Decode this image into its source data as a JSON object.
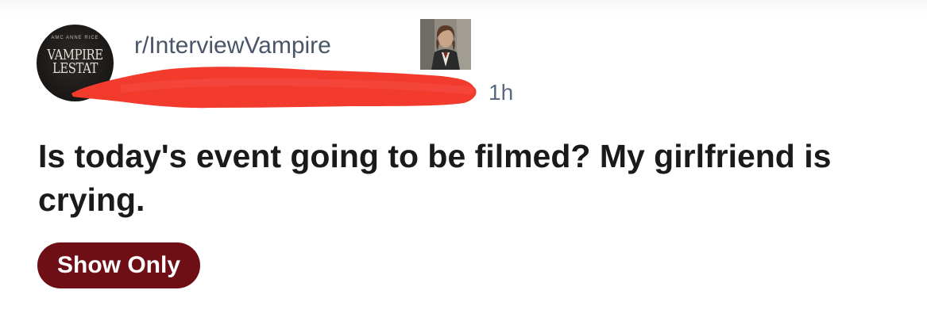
{
  "post": {
    "subreddit": "r/InterviewVampire",
    "community_avatar": {
      "small_text": "AMC ANNE RICE",
      "line1": "VAMPIRE",
      "line2": "LESTAT"
    },
    "dot": "•",
    "time": "1h",
    "title": "Is today's event going to be filmed? My girlfriend is crying.",
    "flair": "Show Only"
  },
  "colors": {
    "subreddit_text": "#4a5568",
    "meta_text": "#5a6a80",
    "title_text": "#1a1a1b",
    "flair_bg": "#6e0f16",
    "flair_text": "#ffffff",
    "redaction": "#f23b2d"
  },
  "icons": {
    "community_avatar": "community-avatar-icon",
    "user_avatar": "user-avatar-image"
  }
}
